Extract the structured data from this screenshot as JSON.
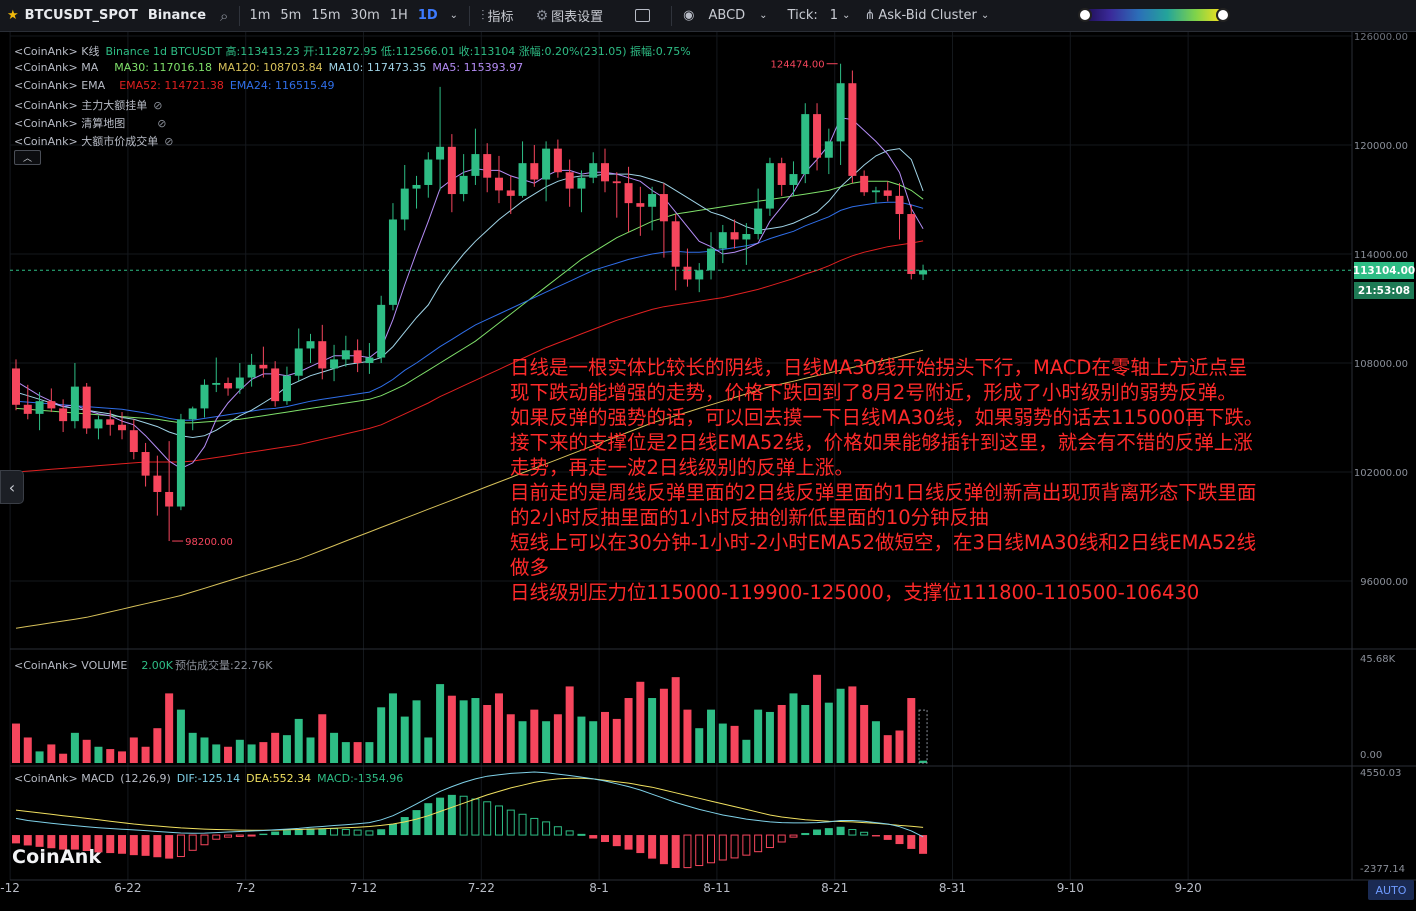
{
  "toolbar": {
    "symbol": "BTCUSDT_SPOT",
    "exchange": "Binance",
    "timeframes": [
      "1m",
      "5m",
      "15m",
      "30m",
      "1H",
      "1D"
    ],
    "active_timeframe": "1D",
    "indicators_label": "指标",
    "chart_settings_label": "图表设置",
    "abcd_label": "ABCD",
    "tick_label": "Tick:",
    "tick_value": "1",
    "cluster_label": "Ask-Bid Cluster"
  },
  "legend": {
    "kline": {
      "prefix": "<CoinAnk> K线",
      "text": "Binance 1d BTCUSDT 高:113413.23 开:112872.95 低:112566.01 收:113104 涨幅:0.20%(231.05) 振幅:0.75%"
    },
    "ma": {
      "prefix": "<CoinAnk> MA",
      "ma30": "MA30: 117016.18",
      "ma120": "MA120: 108703.84",
      "ma10": "MA10: 117473.35",
      "ma5": "MA5: 115393.97"
    },
    "ema": {
      "prefix": "<CoinAnk> EMA",
      "ema52": "EMA52: 114721.38",
      "ema24": "EMA24: 116515.49"
    },
    "orders": "<CoinAnk> 主力大额挂单",
    "liquidation": "<CoinAnk> 清算地图",
    "large_trades": "<CoinAnk> 大额市价成交单",
    "volume": {
      "prefix": "<CoinAnk> VOLUME",
      "value": "2.00K",
      "forecast": "预估成交量:22.76K"
    },
    "macd": {
      "prefix": "<CoinAnk> MACD",
      "params": "(12,26,9)",
      "dif": "DIF:-125.14",
      "dea": "DEA:552.34",
      "macd": "MACD:-1354.96"
    }
  },
  "price_labels": {
    "last_price": "113104.00",
    "countdown": "21:53:08",
    "high_marker": "124474.00",
    "low_marker": "98200.00"
  },
  "annotation_lines": [
    "日线是一根实体比较长的阴线，日线MA30线开始拐头下行，MACD在零轴上方近点呈",
    "现下跌动能增强的走势，价格下跌回到了8月2号附近，形成了小时级别的弱势反弹。",
    "如果反弹的强势的话，可以回去摸一下日线MA30线，如果弱势的话去115000再下跌。",
    "接下来的支撑位是2日线EMA52线，价格如果能够插针到这里，就会有不错的反弹上涨",
    "走势，再走一波2日线级别的反弹上涨。",
    "目前走的是周线反弹里面的2日线反弹里面的1日线反弹创新高出现顶背离形态下跌里面",
    "的2小时反抽里面的1小时反抽创新低里面的10分钟反抽",
    "短线上可以在30分钟-1小时-2小时EMA52做短空，在3日线MA30线和2日线EMA52线",
    "做多",
    "日线级别压力位115000-119900-125000，支撑位111800-110500-106430"
  ],
  "watermark": "CoinAnk",
  "auto_label": "AUTO",
  "colors": {
    "up": "#2ebd85",
    "down": "#f6465d",
    "ma5": "#b48cf5",
    "ma10": "#9fd3e6",
    "ma30": "#7fe06a",
    "ma120": "#d7c15a",
    "ema24": "#2f6ee8",
    "ema52": "#e02020",
    "dif": "#7fd1e8",
    "dea": "#f0e060",
    "annotation": "#ff2a2a"
  },
  "chart_data": {
    "type": "candlestick",
    "x_ticks": [
      "-12",
      "6-22",
      "7-2",
      "7-12",
      "7-22",
      "8-1",
      "8-11",
      "8-21",
      "8-31",
      "9-10",
      "9-20"
    ],
    "y_ticks": [
      "120000.00",
      "114000.00",
      "108000.00",
      "102000.00",
      "96000.00"
    ],
    "y_top_label": "126000.00",
    "volume_ticks": [
      "45.68K",
      "0.00"
    ],
    "macd_ticks": [
      "4550.03",
      "-2377.14"
    ],
    "candles": [
      [
        107700,
        108200,
        105400,
        105700
      ],
      [
        105700,
        106800,
        104900,
        105200
      ],
      [
        105200,
        106400,
        104300,
        105900
      ],
      [
        105900,
        106600,
        105300,
        105500
      ],
      [
        105500,
        106000,
        104200,
        104800
      ],
      [
        104800,
        108000,
        104400,
        106700
      ],
      [
        106700,
        106900,
        104100,
        104400
      ],
      [
        104400,
        105100,
        103800,
        104900
      ],
      [
        104900,
        105400,
        104000,
        104600
      ],
      [
        104600,
        105300,
        103800,
        104300
      ],
      [
        104300,
        104900,
        102700,
        103100
      ],
      [
        103100,
        103600,
        101200,
        101800
      ],
      [
        101800,
        102900,
        99600,
        100900
      ],
      [
        100900,
        103700,
        98200,
        100100
      ],
      [
        100100,
        105200,
        99900,
        104900
      ],
      [
        104900,
        105600,
        104300,
        105500
      ],
      [
        105500,
        107100,
        105000,
        106800
      ],
      [
        106800,
        108300,
        106400,
        106900
      ],
      [
        106900,
        107200,
        106200,
        106600
      ],
      [
        106600,
        108000,
        106300,
        107200
      ],
      [
        107200,
        108500,
        106700,
        107900
      ],
      [
        107900,
        108900,
        107200,
        107700
      ],
      [
        107700,
        108100,
        105600,
        105900
      ],
      [
        105900,
        107800,
        105700,
        107300
      ],
      [
        107300,
        109900,
        107000,
        108800
      ],
      [
        108800,
        109600,
        108000,
        109200
      ],
      [
        109200,
        110100,
        107100,
        107700
      ],
      [
        107700,
        109000,
        107000,
        108200
      ],
      [
        108200,
        109500,
        107800,
        108700
      ],
      [
        108700,
        109300,
        107500,
        108000
      ],
      [
        108000,
        109100,
        107400,
        108300
      ],
      [
        108300,
        111700,
        108000,
        111200
      ],
      [
        111200,
        116800,
        110900,
        115900
      ],
      [
        115900,
        118900,
        115300,
        117600
      ],
      [
        117600,
        118300,
        116500,
        117800
      ],
      [
        117800,
        119600,
        117100,
        119200
      ],
      [
        119200,
        123200,
        117500,
        119900
      ],
      [
        119900,
        120600,
        116300,
        117300
      ],
      [
        117300,
        119500,
        116900,
        118300
      ],
      [
        118300,
        120900,
        117800,
        119500
      ],
      [
        119500,
        120100,
        117400,
        118200
      ],
      [
        118200,
        119400,
        116800,
        117500
      ],
      [
        117500,
        118300,
        116200,
        117200
      ],
      [
        117200,
        120200,
        117100,
        119000
      ],
      [
        119000,
        120000,
        117700,
        118100
      ],
      [
        118100,
        120200,
        116900,
        119800
      ],
      [
        119800,
        120300,
        118200,
        118500
      ],
      [
        118500,
        119200,
        116600,
        117600
      ],
      [
        117600,
        118600,
        116300,
        118200
      ],
      [
        118200,
        119600,
        117900,
        119000
      ],
      [
        119000,
        119800,
        117400,
        118000
      ],
      [
        118000,
        118500,
        116000,
        117900
      ],
      [
        117900,
        118800,
        115200,
        116800
      ],
      [
        116800,
        117700,
        115000,
        116600
      ],
      [
        116600,
        117700,
        115300,
        117300
      ],
      [
        117300,
        117900,
        113800,
        115800
      ],
      [
        115800,
        116200,
        112000,
        113300
      ],
      [
        113300,
        114300,
        112200,
        112600
      ],
      [
        112600,
        113500,
        111900,
        113100
      ],
      [
        113100,
        115200,
        112600,
        114300
      ],
      [
        114300,
        115600,
        113500,
        115200
      ],
      [
        115200,
        115900,
        114300,
        114800
      ],
      [
        114800,
        115700,
        113400,
        115100
      ],
      [
        115100,
        117600,
        114800,
        116500
      ],
      [
        116500,
        119300,
        116100,
        119000
      ],
      [
        119000,
        119300,
        117200,
        117800
      ],
      [
        117800,
        119100,
        117200,
        118400
      ],
      [
        118400,
        122300,
        117900,
        121700
      ],
      [
        121700,
        122300,
        118600,
        119300
      ],
      [
        119300,
        120900,
        118400,
        120200
      ],
      [
        120200,
        124474,
        118900,
        123400
      ],
      [
        123400,
        124100,
        117900,
        118300
      ],
      [
        118300,
        118600,
        117200,
        117400
      ],
      [
        117400,
        117700,
        116800,
        117500
      ],
      [
        117500,
        118000,
        116900,
        117200
      ],
      [
        117200,
        117900,
        114800,
        116200
      ],
      [
        116200,
        116700,
        112600,
        112900
      ],
      [
        112872.95,
        113413.23,
        112566.01,
        113104
      ]
    ],
    "volumes": [
      17,
      11,
      5,
      8,
      4,
      13,
      10,
      7,
      6,
      5,
      11,
      7,
      15,
      30,
      23,
      13,
      11,
      8,
      7,
      10,
      8,
      9,
      13,
      12,
      19,
      11,
      21,
      13,
      9,
      9,
      9,
      24,
      30,
      20,
      27,
      11,
      34,
      29,
      27,
      28,
      25,
      30,
      21,
      18,
      23,
      18,
      21,
      33,
      20,
      18,
      22,
      19,
      28,
      35,
      28,
      32,
      37,
      23,
      15,
      23,
      17,
      16,
      10,
      23,
      22,
      25,
      30,
      25,
      38,
      26,
      32,
      33,
      25,
      18,
      12,
      14,
      28,
      8
    ],
    "ma5": [
      107000,
      106600,
      106200,
      105900,
      105600,
      105700,
      105400,
      105200,
      105100,
      104800,
      104600,
      104000,
      103300,
      102600,
      102200,
      102500,
      103400,
      104900,
      105800,
      106500,
      107100,
      107400,
      107400,
      107300,
      107500,
      107800,
      108100,
      108400,
      108400,
      108400,
      108300,
      108800,
      110400,
      112300,
      114100,
      115800,
      117600,
      118100,
      118500,
      118700,
      118600,
      118600,
      118300,
      118100,
      117900,
      118300,
      118600,
      118600,
      118400,
      118500,
      118500,
      118400,
      118200,
      118000,
      117500,
      117100,
      116300,
      115500,
      114700,
      114400,
      114000,
      114100,
      114300,
      114600,
      115800,
      116600,
      117400,
      118500,
      119200,
      120000,
      121500,
      121400,
      120800,
      120200,
      119500,
      118500,
      116500,
      115393.97
    ],
    "ma10": [
      106400,
      106200,
      106000,
      105800,
      105600,
      105500,
      105400,
      105300,
      105200,
      105000,
      104900,
      104700,
      104500,
      104200,
      104000,
      103900,
      104000,
      104300,
      104700,
      105100,
      105400,
      105800,
      106200,
      106700,
      107000,
      107300,
      107500,
      107700,
      107900,
      108000,
      108100,
      108300,
      108900,
      109700,
      110500,
      111200,
      112300,
      113200,
      114000,
      114700,
      115300,
      115900,
      116400,
      116900,
      117300,
      117700,
      118000,
      118200,
      118300,
      118300,
      118400,
      118400,
      118400,
      118300,
      118100,
      117900,
      117500,
      117100,
      116700,
      116300,
      116100,
      115800,
      115500,
      115300,
      115400,
      115500,
      115700,
      116000,
      116300,
      116900,
      117700,
      118300,
      118900,
      119400,
      119700,
      119800,
      119200,
      117473.35
    ],
    "ma30": [
      105500,
      105450,
      105400,
      105350,
      105300,
      105250,
      105200,
      105150,
      105100,
      105050,
      105000,
      104950,
      104900,
      104800,
      104700,
      104700,
      104750,
      104800,
      104850,
      104900,
      105000,
      105100,
      105200,
      105300,
      105400,
      105500,
      105600,
      105700,
      105800,
      105900,
      106000,
      106200,
      106500,
      106800,
      107200,
      107600,
      108000,
      108400,
      108800,
      109200,
      109700,
      110200,
      110700,
      111200,
      111700,
      112200,
      112700,
      113200,
      113700,
      114100,
      114500,
      114900,
      115200,
      115500,
      115800,
      116000,
      116200,
      116300,
      116400,
      116500,
      116600,
      116700,
      116800,
      116900,
      117000,
      117100,
      117200,
      117300,
      117400,
      117500,
      117700,
      117900,
      118000,
      118000,
      118000,
      117800,
      117500,
      117016.18
    ],
    "ma120": [
      93400,
      93500,
      93600,
      93700,
      93800,
      93900,
      94000,
      94150,
      94300,
      94450,
      94600,
      94750,
      94900,
      95050,
      95200,
      95400,
      95600,
      95800,
      96000,
      96200,
      96400,
      96600,
      96800,
      97000,
      97200,
      97450,
      97700,
      97950,
      98200,
      98450,
      98700,
      98950,
      99200,
      99450,
      99700,
      99950,
      100200,
      100450,
      100700,
      100950,
      101200,
      101450,
      101700,
      101950,
      102200,
      102450,
      102700,
      102950,
      103200,
      103450,
      103700,
      103950,
      104200,
      104450,
      104700,
      104900,
      105100,
      105300,
      105500,
      105700,
      105900,
      106100,
      106300,
      106500,
      106700,
      106850,
      107000,
      107150,
      107300,
      107450,
      107600,
      107750,
      107900,
      108050,
      108200,
      108350,
      108550,
      108703.84
    ],
    "ema24": [
      105900,
      105850,
      105800,
      105750,
      105700,
      105650,
      105600,
      105550,
      105500,
      105450,
      105350,
      105250,
      105100,
      104950,
      104850,
      104850,
      104950,
      105050,
      105150,
      105250,
      105350,
      105450,
      105500,
      105600,
      105750,
      105900,
      106000,
      106100,
      106200,
      106300,
      106400,
      106700,
      107100,
      107600,
      108000,
      108450,
      108900,
      109300,
      109700,
      110100,
      110400,
      110700,
      111000,
      111300,
      111600,
      111900,
      112200,
      112500,
      112800,
      113100,
      113300,
      113500,
      113700,
      113850,
      114000,
      114100,
      114150,
      114100,
      114100,
      114150,
      114250,
      114350,
      114450,
      114600,
      114850,
      115050,
      115250,
      115550,
      115800,
      116050,
      116400,
      116600,
      116700,
      116800,
      116850,
      116850,
      116700,
      116515.49
    ],
    "ema52": [
      102000,
      102050,
      102100,
      102150,
      102200,
      102250,
      102300,
      102350,
      102400,
      102450,
      102500,
      102550,
      102550,
      102550,
      102550,
      102600,
      102700,
      102800,
      102900,
      103000,
      103100,
      103200,
      103300,
      103400,
      103500,
      103650,
      103800,
      103950,
      104100,
      104250,
      104400,
      104600,
      104900,
      105200,
      105500,
      105800,
      106150,
      106450,
      106750,
      107050,
      107350,
      107650,
      107950,
      108250,
      108550,
      108850,
      109100,
      109350,
      109600,
      109850,
      110100,
      110350,
      110550,
      110750,
      110950,
      111100,
      111200,
      111300,
      111400,
      111500,
      111600,
      111750,
      111900,
      112050,
      112250,
      112450,
      112650,
      112900,
      113100,
      113350,
      113650,
      113900,
      114100,
      114250,
      114400,
      114500,
      114600,
      114721.38
    ],
    "macd_hist": [
      -600,
      -750,
      -850,
      -950,
      -1050,
      -1050,
      -1150,
      -1250,
      -1300,
      -1350,
      -1450,
      -1500,
      -1600,
      -1700,
      -1550,
      -1100,
      -700,
      -300,
      -150,
      -100,
      -50,
      100,
      250,
      350,
      400,
      480,
      480,
      460,
      400,
      360,
      300,
      420,
      800,
      1300,
      1800,
      2300,
      2700,
      2900,
      2800,
      2600,
      2400,
      2100,
      1800,
      1500,
      1200,
      950,
      600,
      300,
      50,
      -250,
      -500,
      -800,
      -1050,
      -1300,
      -1700,
      -2100,
      -2377,
      -2350,
      -2200,
      -2000,
      -1800,
      -1650,
      -1450,
      -1200,
      -900,
      -500,
      -150,
      150,
      400,
      500,
      600,
      400,
      200,
      -100,
      -350,
      -650,
      -1000,
      -1354.96
    ],
    "dif": [
      1200,
      1050,
      950,
      850,
      760,
      680,
      600,
      530,
      470,
      420,
      370,
      320,
      260,
      200,
      150,
      130,
      140,
      180,
      220,
      260,
      290,
      330,
      380,
      430,
      480,
      560,
      620,
      690,
      750,
      820,
      900,
      1100,
      1400,
      1800,
      2250,
      2700,
      3150,
      3500,
      3800,
      4050,
      4250,
      4350,
      4450,
      4500,
      4550.03,
      4500,
      4400,
      4300,
      4180,
      4050,
      3900,
      3700,
      3500,
      3250,
      2950,
      2650,
      2350,
      2100,
      1850,
      1650,
      1450,
      1300,
      1150,
      1050,
      950,
      900,
      880,
      880,
      900,
      950,
      1050,
      1050,
      1000,
      900,
      800,
      600,
      300,
      -125.14
    ],
    "dea": [
      1800,
      1700,
      1600,
      1500,
      1400,
      1300,
      1200,
      1100,
      1000,
      900,
      800,
      720,
      650,
      580,
      520,
      470,
      430,
      400,
      380,
      360,
      350,
      350,
      360,
      380,
      400,
      430,
      460,
      490,
      530,
      570,
      620,
      700,
      800,
      950,
      1150,
      1400,
      1700,
      2000,
      2300,
      2600,
      2900,
      3150,
      3400,
      3600,
      3800,
      3950,
      4050,
      4100,
      4100,
      4050,
      3950,
      3850,
      3750,
      3600,
      3450,
      3250,
      3050,
      2850,
      2650,
      2450,
      2250,
      2050,
      1850,
      1650,
      1450,
      1300,
      1200,
      1100,
      1050,
      1000,
      980,
      950,
      900,
      850,
      780,
      700,
      640,
      552.34
    ]
  }
}
